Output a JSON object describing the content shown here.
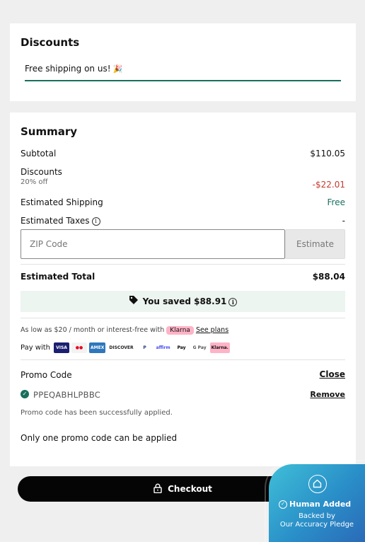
{
  "discounts": {
    "title": "Discounts",
    "applied_text": "Free shipping on us!"
  },
  "summary": {
    "title": "Summary",
    "subtotal_label": "Subtotal",
    "subtotal_value": "$110.05",
    "discounts_label": "Discounts",
    "discounts_sublabel": "20% off",
    "discounts_value": "-$22.01",
    "shipping_label": "Estimated Shipping",
    "shipping_value": "Free",
    "taxes_label": "Estimated Taxes",
    "taxes_value": "-",
    "zip_placeholder": "ZIP Code",
    "estimate_label": "Estimate",
    "total_label": "Estimated Total",
    "total_value": "$88.04",
    "saved_text": "You saved $88.91"
  },
  "financing": {
    "low_as_text": "As low as $20 / month or interest-free with",
    "klarna_label": "Klarna",
    "see_plans_label": "See plans",
    "pay_with_label": "Pay with",
    "payment_methods": {
      "visa": "VISA",
      "mastercard": "●●",
      "amex": "AMEX",
      "discover": "DISCOVER",
      "paypal": "P",
      "affirm": "affirm",
      "apple_pay": "Pay",
      "google_pay": "G Pay",
      "klarna": "Klarna."
    }
  },
  "promo": {
    "title": "Promo Code",
    "close_label": "Close",
    "code": "PPEQABHLPBBC",
    "remove_label": "Remove",
    "success_message": "Promo code has been successfully applied.",
    "limit_message": "Only one promo code can be applied"
  },
  "checkout": {
    "label": "Checkout"
  },
  "badge": {
    "title": "Human Added",
    "line1": "Backed by",
    "line2": "Our Accuracy Pledge"
  },
  "colors": {
    "accent_green": "#17705c",
    "discount_red": "#c53a2f",
    "saved_bg": "#ecf5ef",
    "klarna_pink": "#ffb3c7",
    "checkout_bg": "#050505"
  }
}
